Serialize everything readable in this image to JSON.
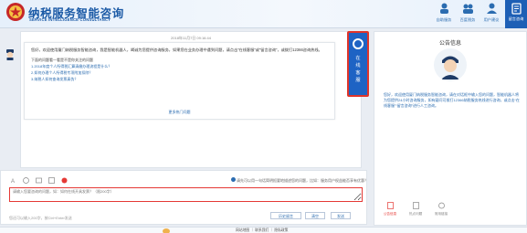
{
  "header": {
    "logo_sub": "",
    "title": "纳税服务智能咨询",
    "subtitle": "SERVICE INTELLIGENCE CONSULTANCY",
    "nav": [
      {
        "label": "自助服务",
        "icon": "self-service-icon"
      },
      {
        "label": "百度税务",
        "icon": "tax-bureau-icon"
      },
      {
        "label": "用户建议",
        "icon": "user-suggestion-icon"
      }
    ],
    "active_nav": {
      "label": "留言咨询",
      "icon": "message-icon"
    },
    "accent": "#1d5fb5"
  },
  "chat": {
    "timestamp": "2018年11月7日  09:16:44",
    "greeting": "您好，欢迎使用厦门纳税服务智能咨询，我是智能机器人，竭诚为您提供咨询服务，如果您在业务办理中遇到问题，请点击“在线客服”或“留言咨询”，或拨打12366咨询热线。",
    "questions_heading": "下面的问题看一看是不是你关注的问题",
    "questions": [
      "1.2018年度个人所得税汇算清缴办理流程是什么？",
      "2.如何办理个人所得税专项附加扣除？",
      "3.纳税人如何查询发票真伪？"
    ],
    "more": "更多热门问题"
  },
  "online_service": {
    "label_1": "在",
    "label_2": "线",
    "label_3": "客",
    "label_4": "服"
  },
  "input": {
    "tip": "请先可以用一句话简明扼要地描述您的问题，比如：服务用户权益能否享有优惠？",
    "placeholder": "请输入您要咨询的问题，如：如何在线开具发票？（限200字）",
    "count": "您还可以输入200字，按Ctrl+Enter发送",
    "buttons": {
      "history": "历史留言",
      "clear": "清空",
      "send": "发送"
    }
  },
  "notice": {
    "title": "公告信息",
    "text": "您好，欢迎使用厦门纳税服务智能咨询，请在对话框中输入您的问题，智能机器人将为您提供24小时咨询服务，如有疑问可拨打12366纳税服务热线进行咨询，或点击“在线客服”“留言咨询”进行人工咨询。",
    "tabs": [
      {
        "label": "公告信息",
        "icon": "notice-icon"
      },
      {
        "label": "热点问题",
        "icon": "hot-icon"
      },
      {
        "label": "常用链接",
        "icon": "link-icon"
      }
    ]
  },
  "footer": {
    "text": "网站地图 ｜ 联系我们 ｜ 隐私政策"
  }
}
